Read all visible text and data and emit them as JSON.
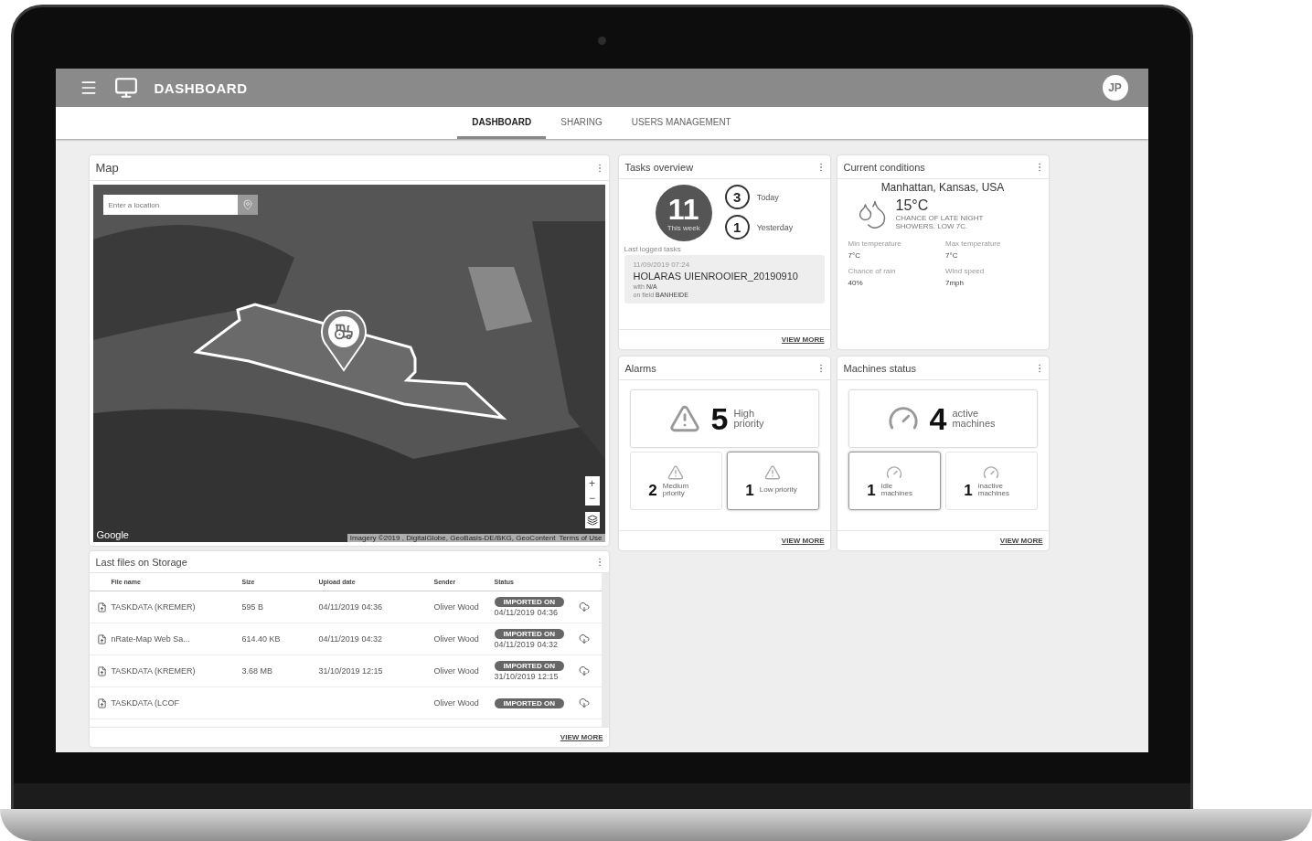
{
  "app_bar": {
    "title": "DASHBOARD",
    "avatar": "JP"
  },
  "tabs": [
    {
      "label": "DASHBOARD",
      "selected": true
    },
    {
      "label": "SHARING",
      "selected": false
    },
    {
      "label": "USERS MANAGEMENT",
      "selected": false
    }
  ],
  "map_card": {
    "title": "Map",
    "search": {
      "placeholder": "Enter a location"
    },
    "zoom_in": "+",
    "zoom_out": "−",
    "logo": "Google",
    "attribution": "Imagery ©2019 , DigitalGlobe, GeoBasis-DE/BKG, GeoContent",
    "terms": "Terms of Use"
  },
  "files_card": {
    "title": "Last files on Storage",
    "columns": [
      "File name",
      "Size",
      "Upload date",
      "Sender",
      "Status"
    ],
    "rows": [
      {
        "name": "TASKDATA (KREMER)",
        "size": "595 B",
        "date": "04/11/2019 04:36",
        "sender": "Oliver Wood",
        "status": "IMPORTED ON",
        "status_date": "04/11/2019 04:36"
      },
      {
        "name": "nRate-Map Web Sa...",
        "size": "614.40 KB",
        "date": "04/11/2019 04:32",
        "sender": "Oliver Wood",
        "status": "IMPORTED ON",
        "status_date": "04/11/2019 04:32"
      },
      {
        "name": "TASKDATA (KREMER)",
        "size": "3.68 MB",
        "date": "31/10/2019 12:15",
        "sender": "Oliver Wood",
        "status": "IMPORTED ON",
        "status_date": "31/10/2019 12:15"
      },
      {
        "name": "TASKDATA (LCOF",
        "sender": "Oliver Wood",
        "status": "IMPORTED ON"
      }
    ],
    "view_more": "VIEW MORE"
  },
  "tasks_card": {
    "title": "Tasks overview",
    "week_count": "11",
    "week_label": "This week",
    "counts": [
      {
        "value": "3",
        "label": "Today"
      },
      {
        "value": "1",
        "label": "Yesterday"
      }
    ],
    "last_label": "Last logged tasks",
    "last_task": {
      "date": "11/09/2019 07:24",
      "name": "HOLARAS UIENROOIER_20190910",
      "with": "with **N/A**",
      "field": "on field **BANHEIDE**"
    },
    "view_more": "VIEW MORE"
  },
  "conditions_card": {
    "title": "Current conditions",
    "location": "Manhattan, Kansas, USA",
    "temperature": "15°C",
    "description": "CHANCE OF LATE NIGHT SHOWERS. LOW 7C.",
    "stats": [
      {
        "label": "Min temperature",
        "value": "7°C"
      },
      {
        "label": "Max temperature",
        "value": "7°C"
      },
      {
        "label": "Chance of rain",
        "value": "40%"
      },
      {
        "label": "Wind speed",
        "value": "7mph"
      }
    ]
  },
  "alarms_card": {
    "title": "Alarms",
    "main": {
      "value": "5",
      "label": "High priority"
    },
    "tiles": [
      {
        "value": "2",
        "label": "Medium priority",
        "selected": false
      },
      {
        "value": "1",
        "label": "Low priority",
        "selected": true
      }
    ],
    "view_more": "VIEW MORE"
  },
  "machines_card": {
    "title": "Machines status",
    "main": {
      "value": "4",
      "label": "active machines"
    },
    "tiles": [
      {
        "value": "1",
        "label": "idle machines",
        "selected": true
      },
      {
        "value": "1",
        "label": "inactive machines",
        "selected": false
      }
    ],
    "view_more": "VIEW MORE"
  }
}
